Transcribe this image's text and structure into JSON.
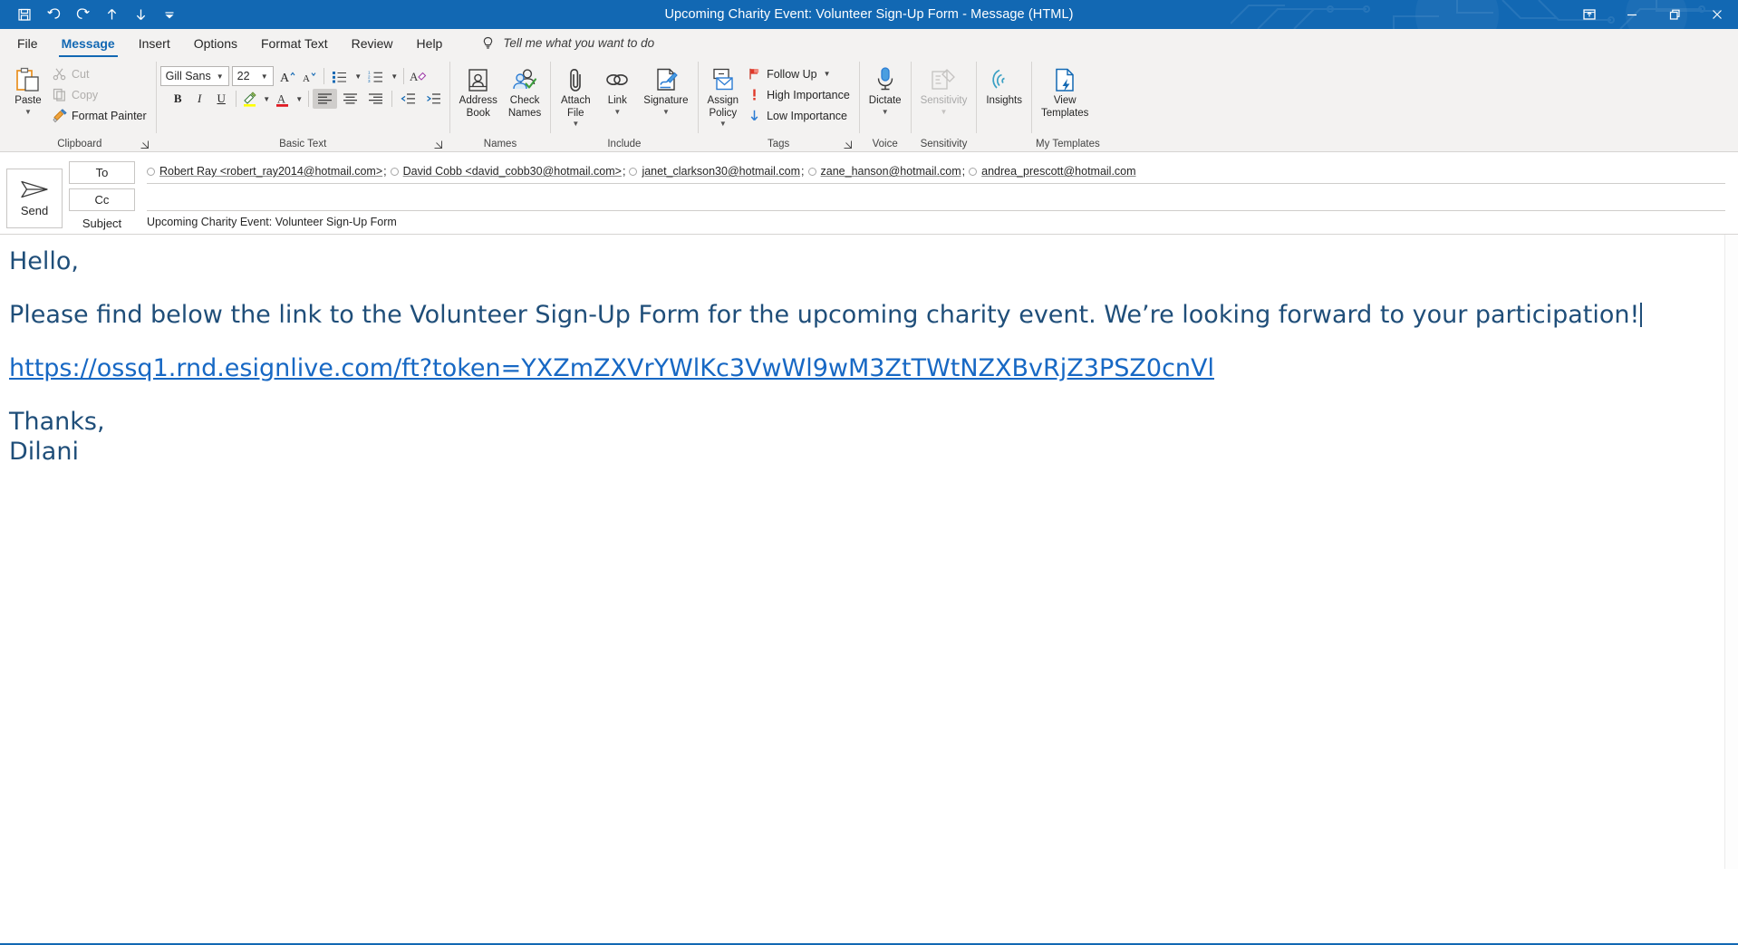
{
  "window": {
    "title": "Upcoming Charity Event: Volunteer Sign-Up Form  -  Message (HTML)",
    "quick_access": [
      {
        "name": "save",
        "tip": "Save"
      },
      {
        "name": "undo",
        "tip": "Undo"
      },
      {
        "name": "redo",
        "tip": "Redo"
      },
      {
        "name": "previous-item",
        "tip": "Previous Item"
      },
      {
        "name": "next-item",
        "tip": "Next Item"
      },
      {
        "name": "customize-quick-access-toolbar",
        "tip": "Customize Quick Access Toolbar"
      }
    ],
    "controls": [
      {
        "name": "ribbon-display-options",
        "tip": "Ribbon Display Options"
      },
      {
        "name": "minimize",
        "tip": "Minimize"
      },
      {
        "name": "restore",
        "tip": "Restore Down"
      },
      {
        "name": "close",
        "tip": "Close"
      }
    ]
  },
  "tabs": [
    {
      "label": "File",
      "active": false
    },
    {
      "label": "Message",
      "active": true
    },
    {
      "label": "Insert",
      "active": false
    },
    {
      "label": "Options",
      "active": false
    },
    {
      "label": "Format Text",
      "active": false
    },
    {
      "label": "Review",
      "active": false
    },
    {
      "label": "Help",
      "active": false
    }
  ],
  "tell_me": "Tell me what you want to do",
  "ribbon": {
    "clipboard": {
      "label": "Clipboard",
      "paste": "Paste",
      "cut": "Cut",
      "copy": "Copy",
      "format_painter": "Format Painter"
    },
    "basic_text": {
      "label": "Basic Text",
      "font_name": "Gill Sans M",
      "font_size": "22",
      "bold": "B",
      "italic": "I",
      "underline": "U"
    },
    "names": {
      "label": "Names",
      "address_book": "Address\nBook",
      "check_names": "Check\nNames"
    },
    "include": {
      "label": "Include",
      "attach_file": "Attach\nFile",
      "link": "Link",
      "signature": "Signature"
    },
    "tags": {
      "label": "Tags",
      "assign_policy": "Assign\nPolicy",
      "follow_up": "Follow Up",
      "high_importance": "High Importance",
      "low_importance": "Low Importance"
    },
    "voice": {
      "label": "Voice",
      "dictate": "Dictate"
    },
    "sensitivity": {
      "label": "Sensitivity",
      "sensitivity": "Sensitivity"
    },
    "insights": {
      "label": "",
      "insights": "Insights"
    },
    "my_templates": {
      "label": "My Templates",
      "view_templates": "View\nTemplates"
    }
  },
  "compose": {
    "send": "Send",
    "to_label": "To",
    "cc_label": "Cc",
    "subject_label": "Subject",
    "subject_value": "Upcoming Charity Event: Volunteer Sign-Up Form",
    "to_recipients": [
      "Robert Ray <robert_ray2014@hotmail.com>",
      "David Cobb <david_cobb30@hotmail.com>",
      "janet_clarkson30@hotmail.com",
      "zane_hanson@hotmail.com",
      "andrea_prescott@hotmail.com"
    ],
    "cc_recipients": []
  },
  "body": {
    "greeting": "Hello,",
    "paragraph": "Please find below the link to the Volunteer Sign-Up Form for the upcoming charity event. We’re looking forward to your participation!",
    "link": "https://ossq1.rnd.esignlive.com/ft?token=YXZmZXVrYWlKc3VwWl9wM3ZtTWtNZXBvRjZ3PSZ0cnVl",
    "closing": "Thanks,",
    "signature": "Dilani"
  },
  "colors": {
    "accent": "#1268b3",
    "body_text": "#1f4e79",
    "link": "#1768c4",
    "ribbon_bg": "#f3f2f1"
  }
}
